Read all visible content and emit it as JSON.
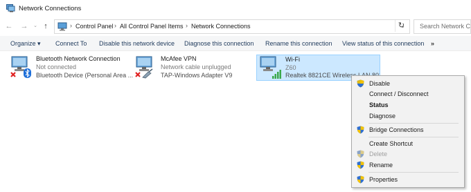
{
  "window": {
    "title": "Network Connections"
  },
  "address": {
    "crumbs": [
      "Control Panel",
      "All Control Panel Items",
      "Network Connections"
    ],
    "search_placeholder": "Search Network Connections"
  },
  "commands": {
    "organize": "Organize ▾",
    "connect_to": "Connect To",
    "disable": "Disable this network device",
    "diagnose": "Diagnose this connection",
    "rename": "Rename this connection",
    "view_status": "View status of this connection",
    "more": "»"
  },
  "connections": [
    {
      "name": "Bluetooth Network Connection",
      "status": "Not connected",
      "device": "Bluetooth Device (Personal Area ..."
    },
    {
      "name": "McAfee VPN",
      "status": "Network cable unplugged",
      "device": "TAP-Windows Adapter V9"
    },
    {
      "name": "Wi-Fi",
      "status": "Z60",
      "device": "Realtek 8821CE Wireless LAN 802..."
    }
  ],
  "context_menu": {
    "disable": "Disable",
    "connect": "Connect / Disconnect",
    "status": "Status",
    "diagnose": "Diagnose",
    "bridge": "Bridge Connections",
    "shortcut": "Create Shortcut",
    "delete": "Delete",
    "rename": "Rename",
    "properties": "Properties"
  },
  "colors": {
    "selection_bg": "#cce8ff",
    "selection_border": "#99d1ff",
    "error_red": "#e02020",
    "bluetooth_blue": "#1e6fd9",
    "signal_green": "#3aa84a"
  }
}
